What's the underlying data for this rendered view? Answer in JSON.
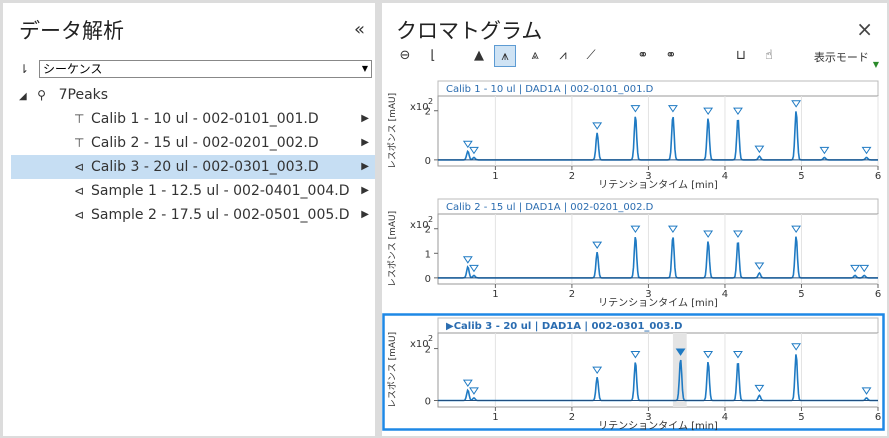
{
  "left_panel": {
    "title": "データ解析",
    "collapse_icon": "«",
    "sequence_select_value": "シーケンス",
    "tree": {
      "root_label": "7Peaks",
      "items": [
        {
          "label": "Calib 1 - 10 ul - 002-0101_001.D",
          "icon": "pin-icon",
          "selected": false
        },
        {
          "label": "Calib 2 - 15 ul - 002-0201_002.D",
          "icon": "pin-icon",
          "selected": false
        },
        {
          "label": "Calib 3 - 20 ul - 002-0301_003.D",
          "icon": "unpin-icon",
          "selected": true
        },
        {
          "label": "Sample 1 - 12.5 ul - 002-0401_004.D",
          "icon": "unpin-icon",
          "selected": false
        },
        {
          "label": "Sample 2 - 17.5 ul - 002-0501_005.D",
          "icon": "unpin-icon",
          "selected": false
        }
      ]
    }
  },
  "right_panel": {
    "title": "クロマトグラム",
    "close_icon": "×",
    "display_mode_label": "表示モード",
    "charts": [
      {
        "title": "Calib 1 - 10 ul | DAD1A | 002-0101_001.D",
        "active": false
      },
      {
        "title": "Calib 2 - 15 ul | DAD1A | 002-0201_002.D",
        "active": false
      },
      {
        "title": "Calib 3 - 20 ul | DAD1A | 002-0301_003.D",
        "active": true
      }
    ]
  },
  "chart_data": [
    {
      "type": "line",
      "title": "Calib 1 - 10 ul | DAD1A | 002-0101_001.D",
      "xlabel": "リテンションタイム [min]",
      "ylabel": "レスポンス [mAU]",
      "y_multiplier_label": "x10",
      "y_multiplier_exp": "2",
      "xlim": [
        0.25,
        6.0
      ],
      "ylim": [
        -0.25,
        2.6
      ],
      "x_ticks": [
        "1",
        "2",
        "3",
        "4",
        "5",
        "6"
      ],
      "y_ticks": [
        "0",
        "2"
      ],
      "peaks": [
        {
          "rt": 0.64,
          "height": 0.35
        },
        {
          "rt": 0.72,
          "height": 0.1
        },
        {
          "rt": 2.33,
          "height": 1.1
        },
        {
          "rt": 2.83,
          "height": 1.8
        },
        {
          "rt": 3.32,
          "height": 1.8
        },
        {
          "rt": 3.78,
          "height": 1.7
        },
        {
          "rt": 4.17,
          "height": 1.7
        },
        {
          "rt": 4.45,
          "height": 0.15
        },
        {
          "rt": 4.93,
          "height": 2.0
        },
        {
          "rt": 5.3,
          "height": 0.1
        },
        {
          "rt": 5.85,
          "height": 0.1
        }
      ]
    },
    {
      "type": "line",
      "title": "Calib 2 - 15 ul | DAD1A | 002-0201_002.D",
      "xlabel": "リテンションタイム [min]",
      "ylabel": "レスポンス [mAU]",
      "y_multiplier_label": "x10",
      "y_multiplier_exp": "2",
      "xlim": [
        0.25,
        6.0
      ],
      "ylim": [
        -0.25,
        2.6
      ],
      "x_ticks": [
        "1",
        "2",
        "3",
        "4",
        "5",
        "6"
      ],
      "y_ticks": [
        "0",
        "1",
        "2"
      ],
      "peaks": [
        {
          "rt": 0.64,
          "height": 0.45
        },
        {
          "rt": 0.72,
          "height": 0.1
        },
        {
          "rt": 2.33,
          "height": 1.05
        },
        {
          "rt": 2.83,
          "height": 1.7
        },
        {
          "rt": 3.32,
          "height": 1.7
        },
        {
          "rt": 3.78,
          "height": 1.5
        },
        {
          "rt": 4.17,
          "height": 1.5
        },
        {
          "rt": 4.45,
          "height": 0.2
        },
        {
          "rt": 4.93,
          "height": 1.7
        },
        {
          "rt": 5.7,
          "height": 0.1
        },
        {
          "rt": 5.82,
          "height": 0.1
        }
      ]
    },
    {
      "type": "line",
      "title": "Calib 3 - 20 ul | DAD1A | 002-0301_003.D",
      "xlabel": "リテンションタイム [min]",
      "ylabel": "レスポンス [mAU]",
      "y_multiplier_label": "x10",
      "y_multiplier_exp": "2",
      "xlim": [
        0.25,
        6.0
      ],
      "ylim": [
        -0.25,
        2.6
      ],
      "x_ticks": [
        "1",
        "2",
        "3",
        "4",
        "5",
        "6"
      ],
      "y_ticks": [
        "0",
        "2"
      ],
      "selected_range": [
        3.32,
        3.5
      ],
      "peaks": [
        {
          "rt": 0.64,
          "height": 0.4
        },
        {
          "rt": 0.72,
          "height": 0.1
        },
        {
          "rt": 2.33,
          "height": 0.9
        },
        {
          "rt": 2.83,
          "height": 1.5
        },
        {
          "rt": 3.42,
          "height": 1.6
        },
        {
          "rt": 3.78,
          "height": 1.5
        },
        {
          "rt": 4.17,
          "height": 1.5
        },
        {
          "rt": 4.45,
          "height": 0.2
        },
        {
          "rt": 4.93,
          "height": 1.8
        },
        {
          "rt": 5.85,
          "height": 0.1
        }
      ]
    }
  ]
}
